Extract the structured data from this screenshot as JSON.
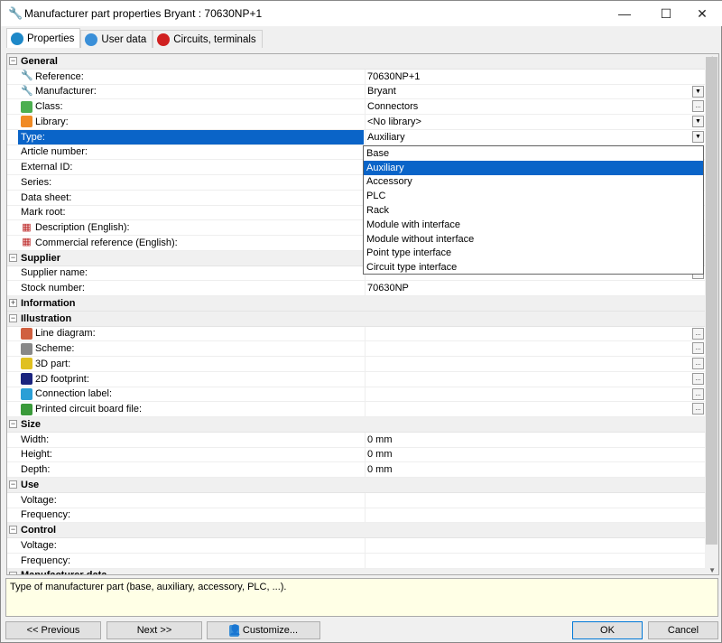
{
  "window": {
    "title": "Manufacturer part properties Bryant : 70630NP+1",
    "minimize": "—",
    "maximize": "☐",
    "close": "✕"
  },
  "tabs": [
    {
      "label": "Properties",
      "icon": "info-icon",
      "color": "#1e88c8"
    },
    {
      "label": "User data",
      "icon": "user-card-icon",
      "color": "#3a8fd8"
    },
    {
      "label": "Circuits, terminals",
      "icon": "circuits-icon",
      "color": "#d02020"
    }
  ],
  "rows": [
    {
      "s": 1,
      "label": "General",
      "exp": "−"
    },
    {
      "label": "Reference:",
      "icon": "wrench-icon",
      "value": "70630NP+1"
    },
    {
      "label": "Manufacturer:",
      "icon": "wrench-icon",
      "value": "Bryant",
      "dd": "▼"
    },
    {
      "label": "Class:",
      "icon": "class-icon",
      "color": "#4caf50",
      "value": "Connectors",
      "dd": "..."
    },
    {
      "label": "Library:",
      "icon": "library-icon",
      "color": "#f08a24",
      "value": "<No library>",
      "dd": "▼"
    },
    {
      "label": "Type:",
      "value": "Auxiliary",
      "dd": "▼",
      "sel": 1
    },
    {
      "label": "Article number:"
    },
    {
      "label": "External ID:"
    },
    {
      "label": "Series:"
    },
    {
      "label": "Data sheet:"
    },
    {
      "label": "Mark root:"
    },
    {
      "label": "Description (English):",
      "icon": "us-flag-icon"
    },
    {
      "label": "Commercial reference (English):",
      "icon": "us-flag-icon"
    },
    {
      "s": 1,
      "label": "Supplier",
      "exp": "−"
    },
    {
      "label": "Supplier name:",
      "dd": "▼"
    },
    {
      "label": "Stock number:",
      "value": "70630NP"
    },
    {
      "s": 1,
      "label": "Information",
      "exp": "+"
    },
    {
      "s": 1,
      "label": "Illustration",
      "exp": "−"
    },
    {
      "label": "Line diagram:",
      "icon": "line-diagram-icon",
      "color": "#d06040",
      "dd": "..."
    },
    {
      "label": "Scheme:",
      "icon": "scheme-icon",
      "color": "#888",
      "dd": "..."
    },
    {
      "label": "3D part:",
      "icon": "3d-part-icon",
      "color": "#e0c020",
      "dd": "..."
    },
    {
      "label": "2D footprint:",
      "icon": "2d-footprint-icon",
      "color": "#1a237e",
      "dd": "..."
    },
    {
      "label": "Connection label:",
      "icon": "connection-label-icon",
      "color": "#2a9fd6",
      "dd": "..."
    },
    {
      "label": "Printed circuit board file:",
      "icon": "pcb-icon",
      "color": "#3a9a3a",
      "dd": "..."
    },
    {
      "s": 1,
      "label": "Size",
      "exp": "−"
    },
    {
      "label": "Width:",
      "value": "0 mm"
    },
    {
      "label": "Height:",
      "value": "0 mm"
    },
    {
      "label": "Depth:",
      "value": "0 mm"
    },
    {
      "s": 1,
      "label": "Use",
      "exp": "−"
    },
    {
      "label": "Voltage:"
    },
    {
      "label": "Frequency:"
    },
    {
      "s": 1,
      "label": "Control",
      "exp": "−"
    },
    {
      "label": "Voltage:"
    },
    {
      "label": "Frequency:"
    },
    {
      "s": 1,
      "label": "Manufacturer data",
      "exp": "−"
    }
  ],
  "type_dropdown": {
    "options": [
      "Base",
      "Auxiliary",
      "Accessory",
      "PLC",
      "Rack",
      "Module with interface",
      "Module without interface",
      "Point type interface",
      "Circuit type interface"
    ],
    "selected": "Auxiliary"
  },
  "description": "Type of manufacturer part (base, auxiliary, accessory, PLC, ...).",
  "buttons": {
    "previous": "<< Previous",
    "next": "Next >>",
    "customize": "Customize...",
    "ok": "OK",
    "cancel": "Cancel"
  },
  "colors": {
    "selection": "#0a64c8",
    "description_bg": "#ffffe6"
  }
}
